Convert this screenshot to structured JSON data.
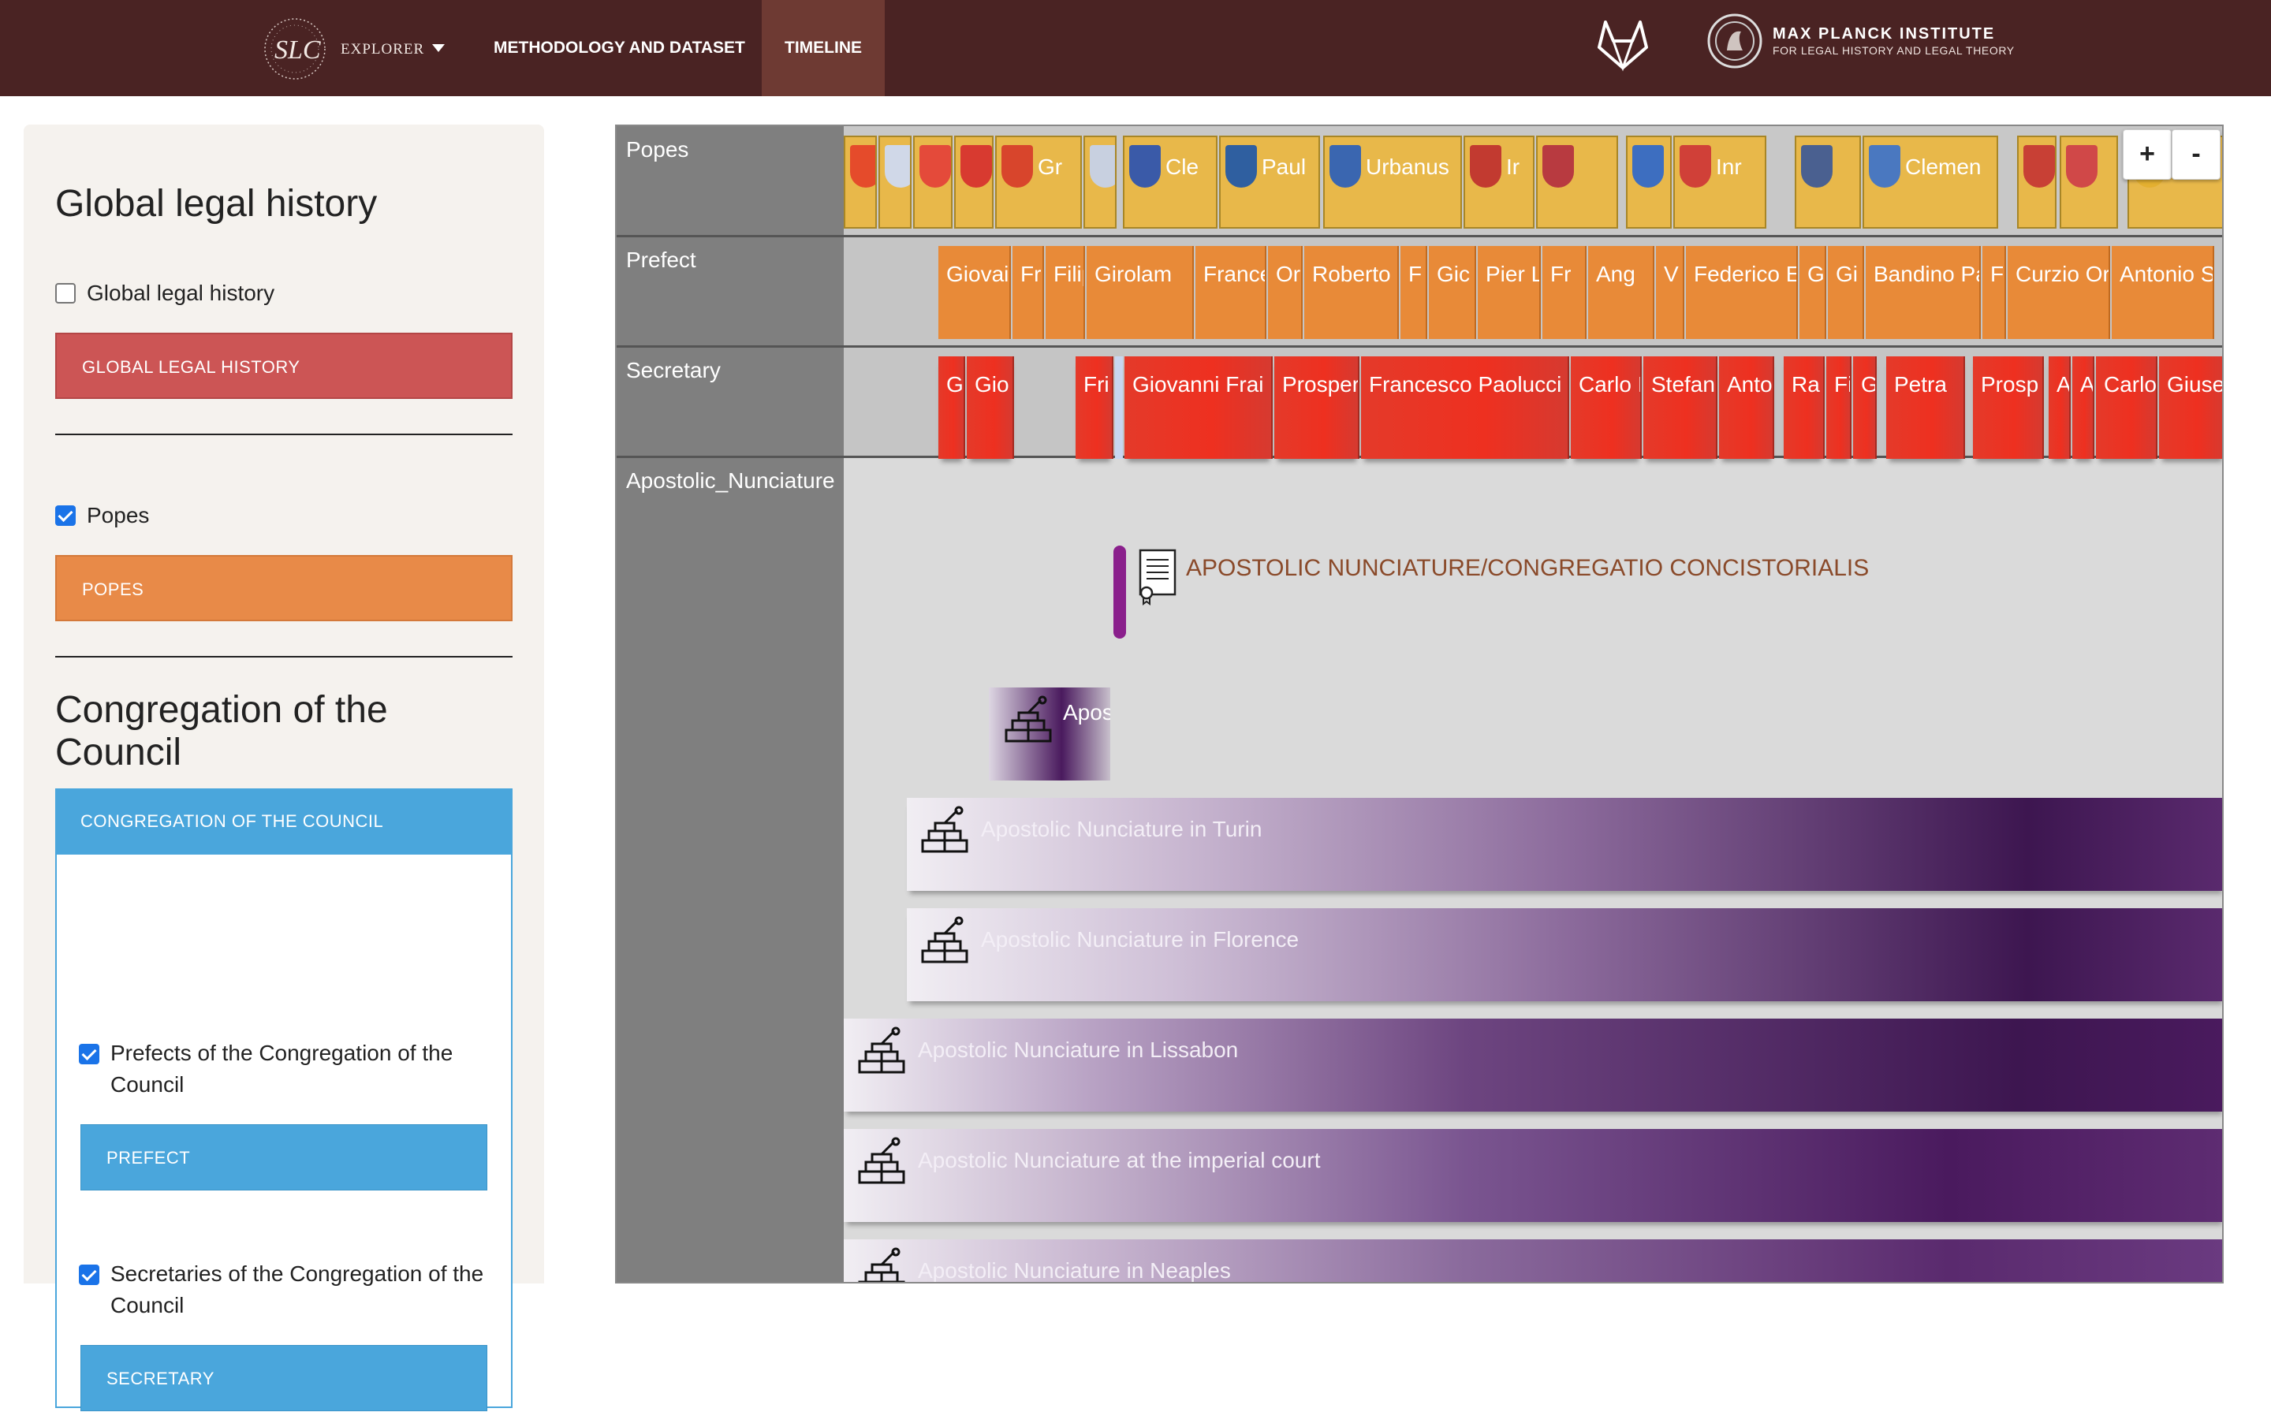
{
  "header": {
    "logo_text": "EXPLORER",
    "nav": [
      "METHODOLOGY AND DATASET",
      "TIMELINE"
    ],
    "active_nav": "TIMELINE",
    "institute_title": "MAX PLANCK INSTITUTE",
    "institute_subtitle": "FOR LEGAL HISTORY AND LEGAL THEORY"
  },
  "sidebar": {
    "section1_title": "Global legal history",
    "global_checkbox_label": "Global legal history",
    "global_button": "GLOBAL LEGAL HISTORY",
    "popes_checkbox_label": "Popes",
    "popes_button": "POPES",
    "section2_title_line1": "Congregation of the",
    "section2_title_line2": "Council",
    "council_button": "CONGREGATION OF THE COUNCIL",
    "prefects_label_line1": "Prefects of the Congregation of the",
    "prefects_label_line2": "Council",
    "prefect_button": "PREFECT",
    "secretaries_label_line1": "Secretaries of the Congregation of the",
    "secretaries_label_line2": "Council",
    "secretary_button": "SECRETARY"
  },
  "timeline": {
    "lanes": [
      "Popes",
      "Prefect",
      "Secretary",
      "Apostolic_Nunciature"
    ],
    "zoom_in": "+",
    "zoom_out": "-",
    "popes": [
      {
        "label": "Gr"
      },
      {
        "label": "Cle"
      },
      {
        "label": "Paul"
      },
      {
        "label": "Urbanus"
      },
      {
        "label": "Ir"
      },
      {
        "label": "Inr"
      },
      {
        "label": "Clemen"
      }
    ],
    "prefects": [
      "Giovai",
      "Fr",
      "Filiponi",
      "Girolam",
      "France",
      "Or",
      "Roberto",
      "F",
      "Gic",
      "Pier L",
      "Fr",
      "Ang",
      "V",
      "Federico E",
      "G",
      "Gi",
      "Bandino Pa",
      "F",
      "Curzio Or",
      "Antonio S"
    ],
    "secretaries": [
      "G",
      "Gio",
      "Fri",
      "Giovanni Frai",
      "Prosper",
      "Francesco Paolucci",
      "Carlo I",
      "Stefano",
      "Anto",
      "Ra",
      "Fi",
      "G",
      "Petra",
      "Prosp",
      "A",
      "A",
      "Carlo",
      "Giusep"
    ],
    "nunciature_event": "APOSTOLIC NUNCIATURE/CONGREGATIO CONCISTORIALIS",
    "nunciature_small": "Apos",
    "nunciatures": [
      "Apostolic Nunciature in Turin",
      "Apostolic Nunciature in Florence",
      "Apostolic Nunciature in Lissabon",
      "Apostolic Nunciature at the imperial court",
      "Apostolic Nunciature in Neaples"
    ]
  },
  "colors": {
    "header_bg": "#4a2323",
    "global_red": "#cc5555",
    "popes_orange": "#e88a48",
    "council_blue": "#4aa6dc",
    "nunciature_purple": "#4a1a5e"
  }
}
